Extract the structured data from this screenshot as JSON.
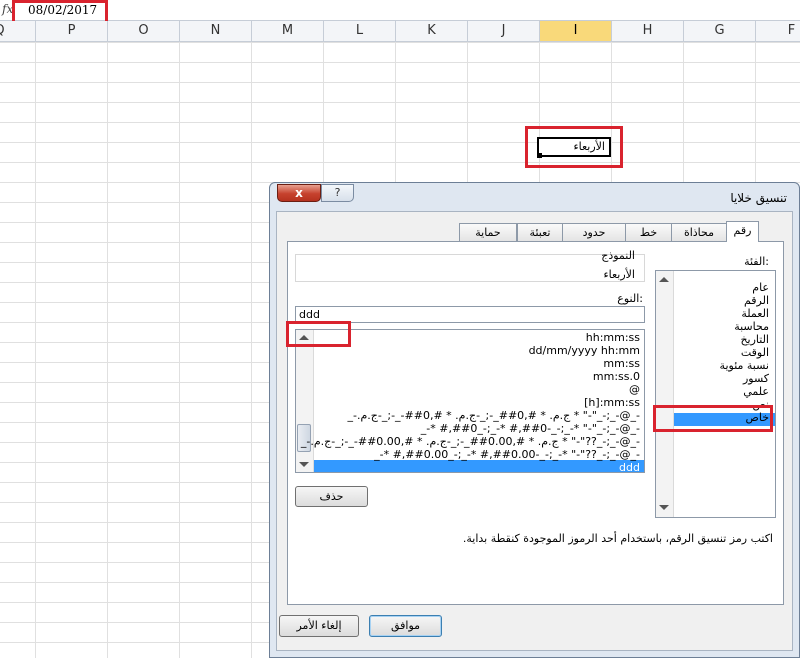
{
  "formula_bar": {
    "fx_label": "fx",
    "value": "08/02/2017"
  },
  "columns": [
    "Q",
    "P",
    "O",
    "N",
    "M",
    "L",
    "K",
    "J",
    "I",
    "H",
    "G",
    "F"
  ],
  "selected_column": "I",
  "active_cell": {
    "display": "الأربعاء"
  },
  "dialog": {
    "title": "تنسيق خلايا",
    "close_label": "x",
    "help_label": "?",
    "tabs": [
      {
        "label": "رقم",
        "active": true
      },
      {
        "label": "محاذاة"
      },
      {
        "label": "خط"
      },
      {
        "label": "حدود"
      },
      {
        "label": "تعبئة"
      },
      {
        "label": "حماية"
      }
    ],
    "category_label": "الفئة:",
    "categories": [
      "عام",
      "الرقم",
      "العملة",
      "محاسبة",
      "التاريخ",
      "الوقت",
      "نسبة مئوية",
      "كسور",
      "علمي",
      "نص",
      "خاص",
      "مخصص"
    ],
    "selected_category": "مخصص",
    "sample_label": "النموذج",
    "sample_value": "الأربعاء",
    "type_label": "النوع:",
    "type_value": "ddd",
    "formats": [
      "hh:mm:ss",
      "dd/mm/yyyy hh:mm",
      "mm:ss",
      "mm:ss.0",
      "@",
      "[h]:mm:ss",
      "_-ج.م.‏ * #,##0_-;_-ج.م.‏ * #,##0-_-;_-ج.م.‏ * \"-\"_-;_-@_-",
      "_-* #,##0_-;_-* #,##0-_-;_-* \"-\"_-;_-@_-",
      "_-ج.م.‏ * #,##0.00_-;_-ج.م.‏ * #,##0.00-_-;_-ج.م.‏ * \"-\"??_-;_-@_-",
      "_-* #,##0.00_-;_-* #,##0.00-_-;_-* \"-\"??_-;_-@_-",
      "ddd"
    ],
    "selected_format": "ddd",
    "delete_label": "حذف",
    "hint": "اكتب رمز تنسيق الرقم، باستخدام أحد الرموز الموجودة كنقطة بداية.",
    "ok_label": "موافق",
    "cancel_label": "إلغاء الأمر"
  }
}
